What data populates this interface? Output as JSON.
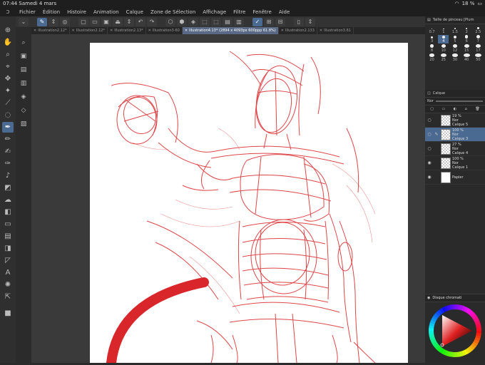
{
  "status": {
    "time": "07:44",
    "date": "Samedi 4 mars",
    "battery": "18 %"
  },
  "menu": [
    "Fichier",
    "Édition",
    "Histoire",
    "Animation",
    "Calque",
    "Zone de Sélection",
    "Affichage",
    "Filtre",
    "Fenêtre",
    "Aide"
  ],
  "tabs": [
    {
      "label": "Illustration2.12*",
      "active": false
    },
    {
      "label": "Illustration2.12*",
      "active": false
    },
    {
      "label": "Illustration2.13*",
      "active": false
    },
    {
      "label": "Illustration3-60",
      "active": false
    },
    {
      "label": "Illustration4.13* (2894 x 4093px 600ppp 61.8%)",
      "active": true
    },
    {
      "label": "Illustration2.133",
      "active": false
    },
    {
      "label": "Illustration3.61",
      "active": false
    }
  ],
  "brush_panel": {
    "title": "Taille de pinceau [Plum",
    "sizes": [
      "0.7",
      "1",
      "1.5",
      "2",
      "2.5",
      "3",
      "4",
      "5",
      "6",
      "7",
      "8",
      "10",
      "12",
      "15",
      "17",
      "20",
      "25",
      "30",
      "40",
      "50"
    ],
    "selected": "4"
  },
  "layer_panel": {
    "title": "Calque",
    "blend": "Nor",
    "layers": [
      {
        "opacity": "19 %",
        "blend": "Nor",
        "name": "Calque 5",
        "visible": false,
        "selected": false
      },
      {
        "opacity": "100 %",
        "blend": "Nor",
        "name": "Calque 3",
        "visible": false,
        "selected": true
      },
      {
        "opacity": "27 %",
        "blend": "Nor",
        "name": "Calque 4",
        "visible": false,
        "selected": false
      },
      {
        "opacity": "100 %",
        "blend": "Nor",
        "name": "Calque 1",
        "visible": true,
        "selected": false
      },
      {
        "opacity": "",
        "blend": "",
        "name": "Papier",
        "visible": true,
        "selected": false
      }
    ]
  },
  "color_panel": {
    "title": "Disque chromati"
  },
  "colors": {
    "main": "#1e1e1e",
    "accent": "#4b6a92",
    "stroke": "#d9262a",
    "selected_tab": "#5a6a86"
  }
}
